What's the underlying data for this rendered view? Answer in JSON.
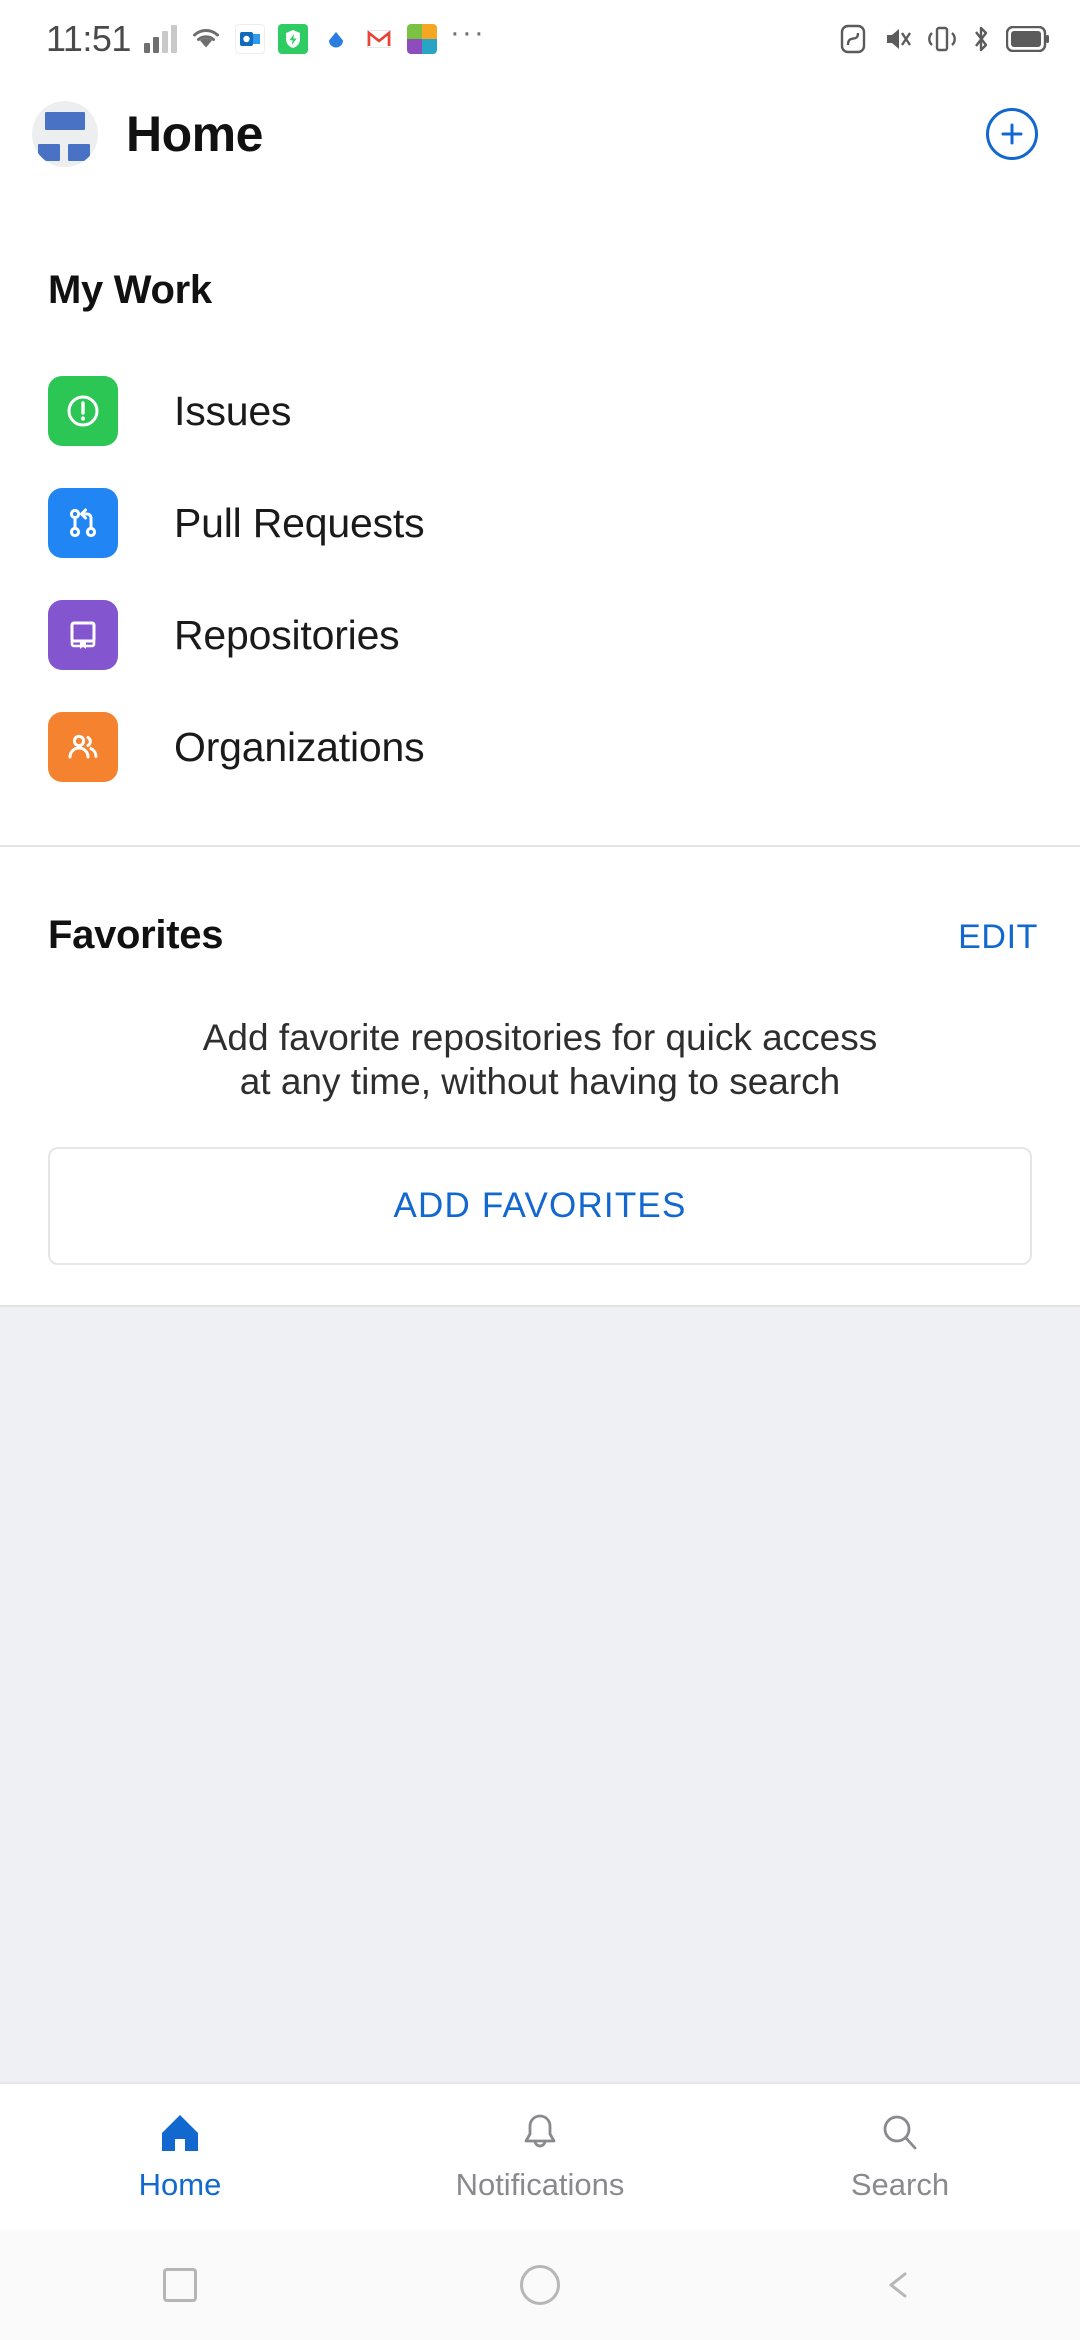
{
  "status_bar": {
    "time": "11:51",
    "left_icons": [
      {
        "name": "signal-bars-icon",
        "glyph": "signal"
      },
      {
        "name": "wifi-icon",
        "glyph": "wifi"
      },
      {
        "name": "outlook-app-icon",
        "glyph": "O"
      },
      {
        "name": "shield-app-icon",
        "glyph": "⚡"
      },
      {
        "name": "dropbox-app-icon",
        "glyph": "◆"
      },
      {
        "name": "gmail-app-icon",
        "glyph": "M"
      },
      {
        "name": "app-grid-icon",
        "glyph": "grid"
      },
      {
        "name": "more-notifications-icon",
        "glyph": "···"
      }
    ],
    "right_icons": [
      {
        "name": "nfc-icon"
      },
      {
        "name": "mute-icon"
      },
      {
        "name": "vibrate-icon"
      },
      {
        "name": "bluetooth-icon"
      },
      {
        "name": "battery-icon"
      }
    ]
  },
  "header": {
    "title": "Home",
    "avatar_name": "user-avatar",
    "add_button_label": "+"
  },
  "my_work": {
    "section_title": "My Work",
    "items": [
      {
        "label": "Issues",
        "icon": "issue-opened-icon",
        "color": "#2cc655"
      },
      {
        "label": "Pull Requests",
        "icon": "git-pull-request-icon",
        "color": "#2186f3"
      },
      {
        "label": "Repositories",
        "icon": "repo-book-icon",
        "color": "#8356cf"
      },
      {
        "label": "Organizations",
        "icon": "organization-people-icon",
        "color": "#f5822f"
      }
    ]
  },
  "favorites": {
    "section_title": "Favorites",
    "edit_label": "EDIT",
    "empty_line1": "Add favorite repositories for quick access",
    "empty_line2": "at any time, without having to search",
    "add_button_label": "ADD FAVORITES"
  },
  "bottom_nav": {
    "items": [
      {
        "label": "Home",
        "icon": "home-icon",
        "active": true
      },
      {
        "label": "Notifications",
        "icon": "bell-icon",
        "active": false
      },
      {
        "label": "Search",
        "icon": "search-icon",
        "active": false
      }
    ]
  },
  "system_nav": {
    "items": [
      {
        "name": "recents-square-icon"
      },
      {
        "name": "home-circle-icon"
      },
      {
        "name": "back-triangle-icon"
      }
    ]
  },
  "colors": {
    "accent_blue": "#1268cf",
    "text_primary": "#111111",
    "text_muted": "#8a8a8e"
  }
}
